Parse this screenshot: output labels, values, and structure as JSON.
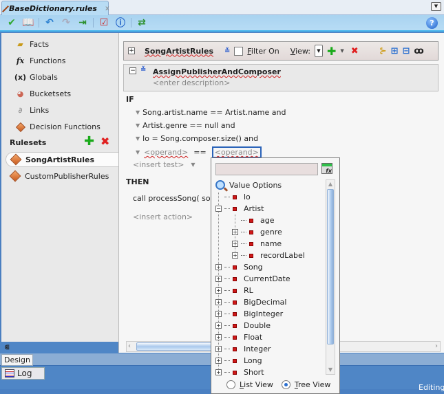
{
  "tab": {
    "title": "BaseDictionary.rules",
    "close": "x"
  },
  "toolbar": {
    "icons": [
      "validate-icon",
      "book-icon",
      "undo-icon",
      "redo-icon",
      "import-icon",
      "checklist-icon",
      "info-icon",
      "link-icon"
    ],
    "help": "?"
  },
  "leftnav": {
    "items": [
      {
        "label": "Facts",
        "icon": "facts-icon"
      },
      {
        "label": "Functions",
        "icon": "function-icon"
      },
      {
        "label": "Globals",
        "icon": "globals-icon"
      },
      {
        "label": "Bucketsets",
        "icon": "bucketsets-icon"
      },
      {
        "label": "Links",
        "icon": "links-icon"
      },
      {
        "label": "Decision Functions",
        "icon": "decision-function-icon"
      }
    ],
    "rulesets_label": "Rulesets",
    "rulesets": [
      {
        "label": "SongArtistRules",
        "selected": true
      },
      {
        "label": "CustomPublisherRules",
        "selected": false
      }
    ],
    "collapse_glyph": "⋐"
  },
  "ruleset_header": {
    "toggle": "+",
    "name": "SongArtistRules",
    "filter_label_mnemonic": "F",
    "filter_label_rest": "ilter On",
    "filter_checked": false,
    "view_label_mnemonic": "V",
    "view_label_rest": "iew:"
  },
  "rule": {
    "toggle": "−",
    "name": "AssignPublisherAndComposer",
    "description_placeholder": "<enter description>",
    "if_label": "IF",
    "tests": [
      "Song.artist.name  ==  Artist.name and",
      "Artist.genre  ==  null and",
      "lo = Song.composer.size() and"
    ],
    "operand_left": "<operand>",
    "operator": "==",
    "operand_right": "<operand>",
    "insert_test": "<insert test>",
    "then_label": "THEN",
    "action": "call processSong( so",
    "insert_action": "<insert action>"
  },
  "popup": {
    "input_value": "",
    "header": "Value Options",
    "tree": [
      {
        "label": "lo",
        "level": 1,
        "expander": ""
      },
      {
        "label": "Artist",
        "level": 1,
        "expander": "−"
      },
      {
        "label": "age",
        "level": 2,
        "expander": ""
      },
      {
        "label": "genre",
        "level": 2,
        "expander": "+"
      },
      {
        "label": "name",
        "level": 2,
        "expander": "+"
      },
      {
        "label": "recordLabel",
        "level": 2,
        "expander": "+"
      },
      {
        "label": "Song",
        "level": 1,
        "expander": "+"
      },
      {
        "label": "CurrentDate",
        "level": 1,
        "expander": "+"
      },
      {
        "label": "RL",
        "level": 1,
        "expander": "+"
      },
      {
        "label": "BigDecimal",
        "level": 1,
        "expander": "+"
      },
      {
        "label": "BigInteger",
        "level": 1,
        "expander": "+"
      },
      {
        "label": "Double",
        "level": 1,
        "expander": "+"
      },
      {
        "label": "Float",
        "level": 1,
        "expander": "+"
      },
      {
        "label": "Integer",
        "level": 1,
        "expander": "+"
      },
      {
        "label": "Long",
        "level": 1,
        "expander": "+"
      },
      {
        "label": "Short",
        "level": 1,
        "expander": "+"
      }
    ],
    "list_view_mnemonic": "L",
    "list_view_rest": "ist View",
    "tree_view_mnemonic": "T",
    "tree_view_rest": "ree View",
    "selected_view": "Tree View"
  },
  "bottom": {
    "design_tab": "Design",
    "log_tab": "Log",
    "status": "Editing"
  }
}
